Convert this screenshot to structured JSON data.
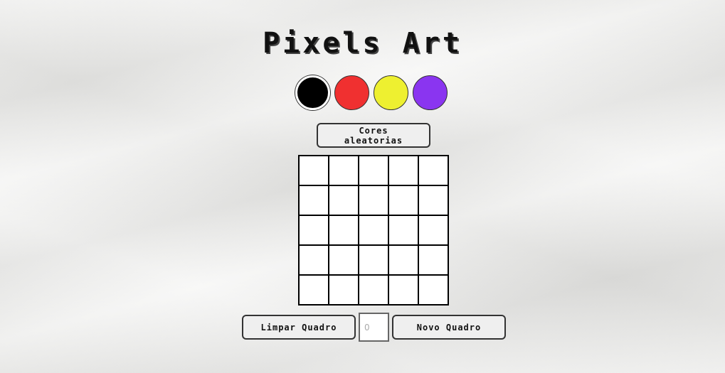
{
  "header": {
    "title": "Pixels Art"
  },
  "palette": {
    "colors": [
      "#000000",
      "#f03030",
      "#eef030",
      "#8a35f0"
    ],
    "selected_index": 0
  },
  "controls": {
    "random_colors_label_line1": "Cores",
    "random_colors_label_line2": "aleatorias",
    "clear_label": "Limpar Quadro",
    "board_size_placeholder": "0",
    "board_size_value": "",
    "new_board_label": "Novo Quadro"
  },
  "board": {
    "rows": 5,
    "cols": 5,
    "cell_color": "#ffffff"
  }
}
